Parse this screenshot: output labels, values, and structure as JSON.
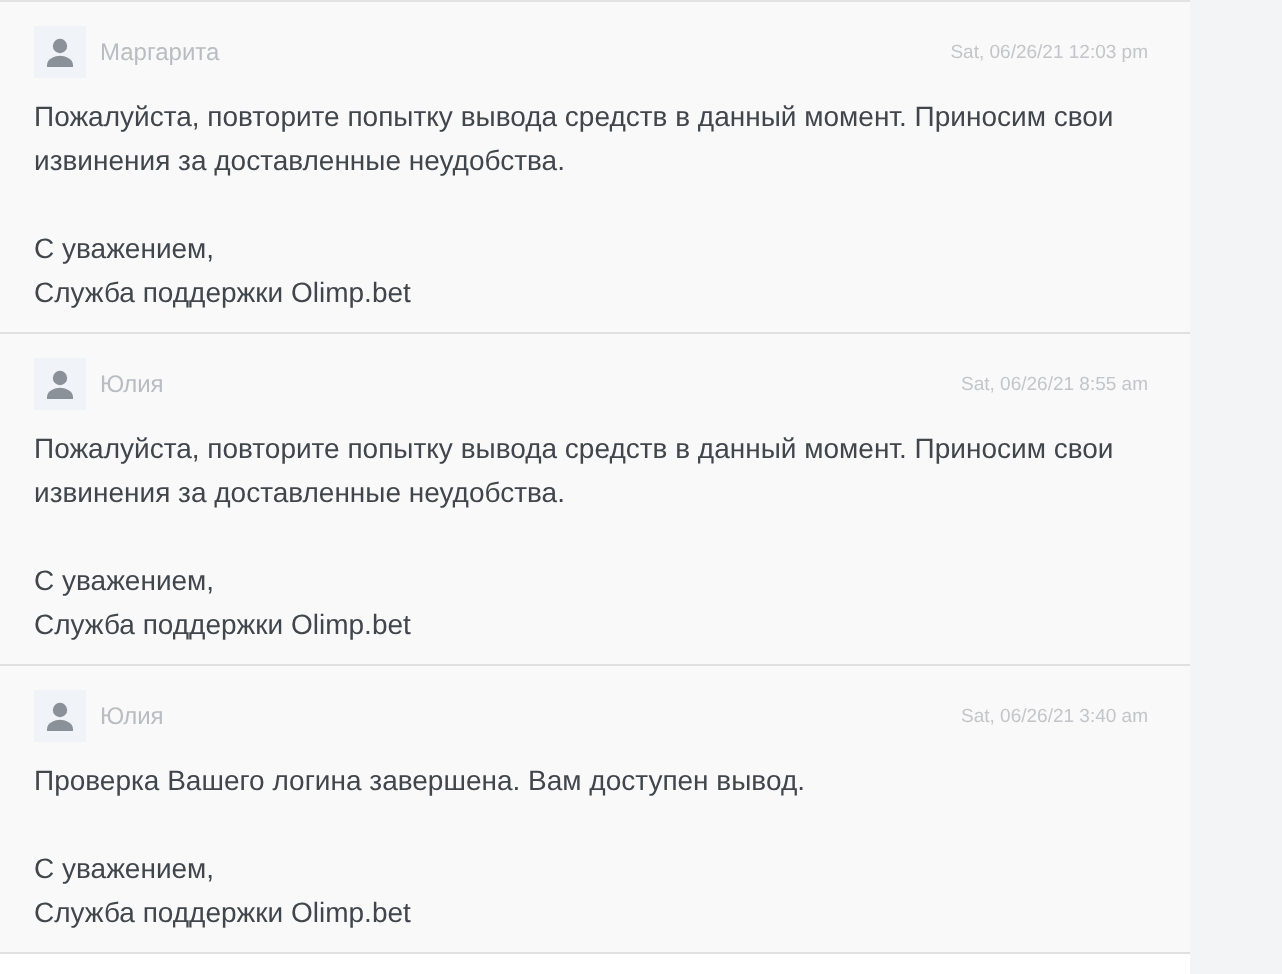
{
  "messages": [
    {
      "author": "Маргарита",
      "time": "Sat, 06/26/21 12:03 pm",
      "text": "Пожалуйста, повторите попытку вывода средств в данный момент. Приносим свои извинения за доставленные неудобства.",
      "signature": [
        "С уважением,",
        "Служба поддержки Olimp.bet"
      ]
    },
    {
      "author": "Юлия",
      "time": "Sat, 06/26/21 8:55 am",
      "text": "Пожалуйста, повторите попытку вывода средств в данный момент. Приносим свои извинения за доставленные неудобства.",
      "signature": [
        "С уважением,",
        "Служба поддержки Olimp.bet"
      ]
    },
    {
      "author": "Юлия",
      "time": "Sat, 06/26/21 3:40 am",
      "text": "Проверка Вашего логина завершена. Вам доступен вывод.",
      "signature": [
        "С уважением,",
        "Служба поддержки Olimp.bet"
      ]
    }
  ]
}
